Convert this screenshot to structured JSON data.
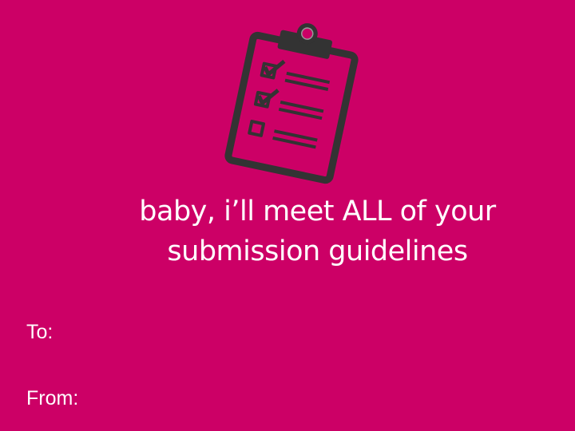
{
  "headline": {
    "line1": "baby, i’ll meet ALL of your",
    "line2": "submission guidelines"
  },
  "to_label": "To:",
  "from_label": "From:",
  "colors": {
    "background": "#cc0066",
    "icon": "#333333",
    "text": "#ffffff"
  },
  "icon": "clipboard-checklist-icon"
}
